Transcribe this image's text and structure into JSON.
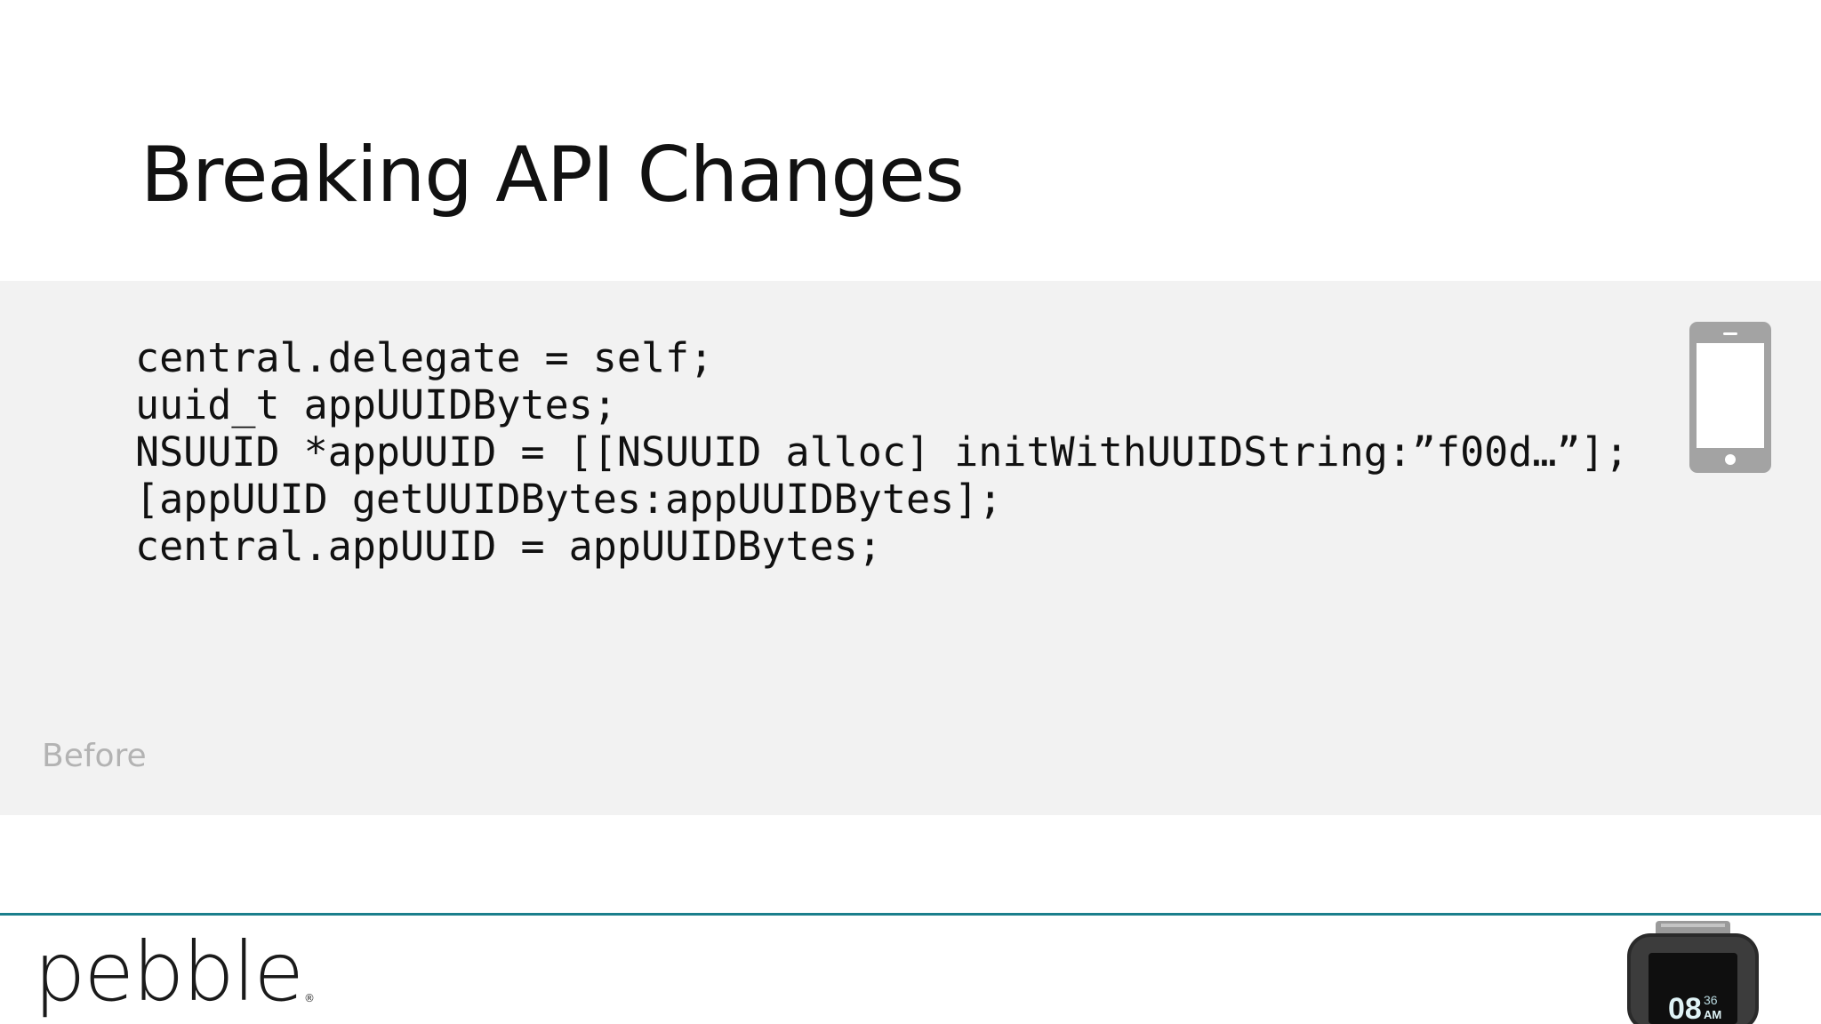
{
  "slide": {
    "title": "Breaking API Changes"
  },
  "code_panel": {
    "lines": [
      "central.delegate = self;",
      "uuid_t appUUIDBytes;",
      "NSUUID *appUUID = [[NSUUID alloc] initWithUUIDString:”f00d…”];",
      "[appUUID getUUIDBytes:appUUIDBytes];",
      "central.appUUID = appUUIDBytes;"
    ],
    "label": "Before",
    "icon": "phone-icon",
    "background_color": "#f2f2f2"
  },
  "footer": {
    "logo_text": "pebble",
    "logo_mark": "®",
    "rule_color": "#1b7f8c",
    "watch": {
      "icon": "watch-image",
      "hour": "08",
      "minute": "36",
      "ampm": "AM"
    }
  }
}
